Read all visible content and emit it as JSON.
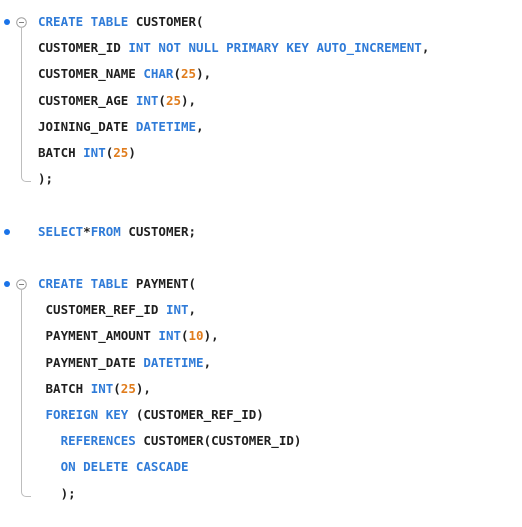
{
  "colors": {
    "keyword": "#2f7bd8",
    "number": "#e07c1c",
    "text": "#1f1f1f",
    "bullet": "#1a73e8"
  },
  "statements": [
    {
      "lines": [
        [
          {
            "t": "CREATE TABLE",
            "k": "kw"
          },
          {
            "t": " CUSTOMER(",
            "k": "tx"
          }
        ],
        [
          {
            "t": "CUSTOMER_ID ",
            "k": "tx"
          },
          {
            "t": "INT NOT NULL PRIMARY KEY AUTO_INCREMENT",
            "k": "kw"
          },
          {
            "t": ",",
            "k": "tx"
          }
        ],
        [
          {
            "t": "CUSTOMER_NAME ",
            "k": "tx"
          },
          {
            "t": "CHAR",
            "k": "kw"
          },
          {
            "t": "(",
            "k": "tx"
          },
          {
            "t": "25",
            "k": "num"
          },
          {
            "t": "),",
            "k": "tx"
          }
        ],
        [
          {
            "t": "CUSTOMER_AGE ",
            "k": "tx"
          },
          {
            "t": "INT",
            "k": "kw"
          },
          {
            "t": "(",
            "k": "tx"
          },
          {
            "t": "25",
            "k": "num"
          },
          {
            "t": "),",
            "k": "tx"
          }
        ],
        [
          {
            "t": "JOINING_DATE ",
            "k": "tx"
          },
          {
            "t": "DATETIME",
            "k": "kw"
          },
          {
            "t": ",",
            "k": "tx"
          }
        ],
        [
          {
            "t": "BATCH ",
            "k": "tx"
          },
          {
            "t": "INT",
            "k": "kw"
          },
          {
            "t": "(",
            "k": "tx"
          },
          {
            "t": "25",
            "k": "num"
          },
          {
            "t": ")",
            "k": "tx"
          }
        ],
        [
          {
            "t": ");",
            "k": "tx"
          }
        ]
      ]
    },
    {
      "lines": [
        [
          {
            "t": "SELECT",
            "k": "kw"
          },
          {
            "t": "*",
            "k": "tx"
          },
          {
            "t": "FROM",
            "k": "kw"
          },
          {
            "t": " CUSTOMER;",
            "k": "tx"
          }
        ]
      ]
    },
    {
      "lines": [
        [
          {
            "t": "CREATE TABLE",
            "k": "kw"
          },
          {
            "t": " PAYMENT(",
            "k": "tx"
          }
        ],
        [
          {
            "t": " CUSTOMER_REF_ID ",
            "k": "tx"
          },
          {
            "t": "INT",
            "k": "kw"
          },
          {
            "t": ",",
            "k": "tx"
          }
        ],
        [
          {
            "t": " PAYMENT_AMOUNT ",
            "k": "tx"
          },
          {
            "t": "INT",
            "k": "kw"
          },
          {
            "t": "(",
            "k": "tx"
          },
          {
            "t": "10",
            "k": "num"
          },
          {
            "t": "),",
            "k": "tx"
          }
        ],
        [
          {
            "t": " PAYMENT_DATE ",
            "k": "tx"
          },
          {
            "t": "DATETIME",
            "k": "kw"
          },
          {
            "t": ",",
            "k": "tx"
          }
        ],
        [
          {
            "t": " BATCH ",
            "k": "tx"
          },
          {
            "t": "INT",
            "k": "kw"
          },
          {
            "t": "(",
            "k": "tx"
          },
          {
            "t": "25",
            "k": "num"
          },
          {
            "t": "),",
            "k": "tx"
          }
        ],
        [
          {
            "t": " FOREIGN KEY",
            "k": "kw"
          },
          {
            "t": " (CUSTOMER_REF_ID)",
            "k": "tx"
          }
        ],
        [
          {
            "t": "   REFERENCES",
            "k": "kw"
          },
          {
            "t": " CUSTOMER(CUSTOMER_ID)",
            "k": "tx"
          }
        ],
        [
          {
            "t": "   ON DELETE CASCADE",
            "k": "kw"
          }
        ],
        [
          {
            "t": "   );",
            "k": "tx"
          }
        ]
      ]
    }
  ]
}
